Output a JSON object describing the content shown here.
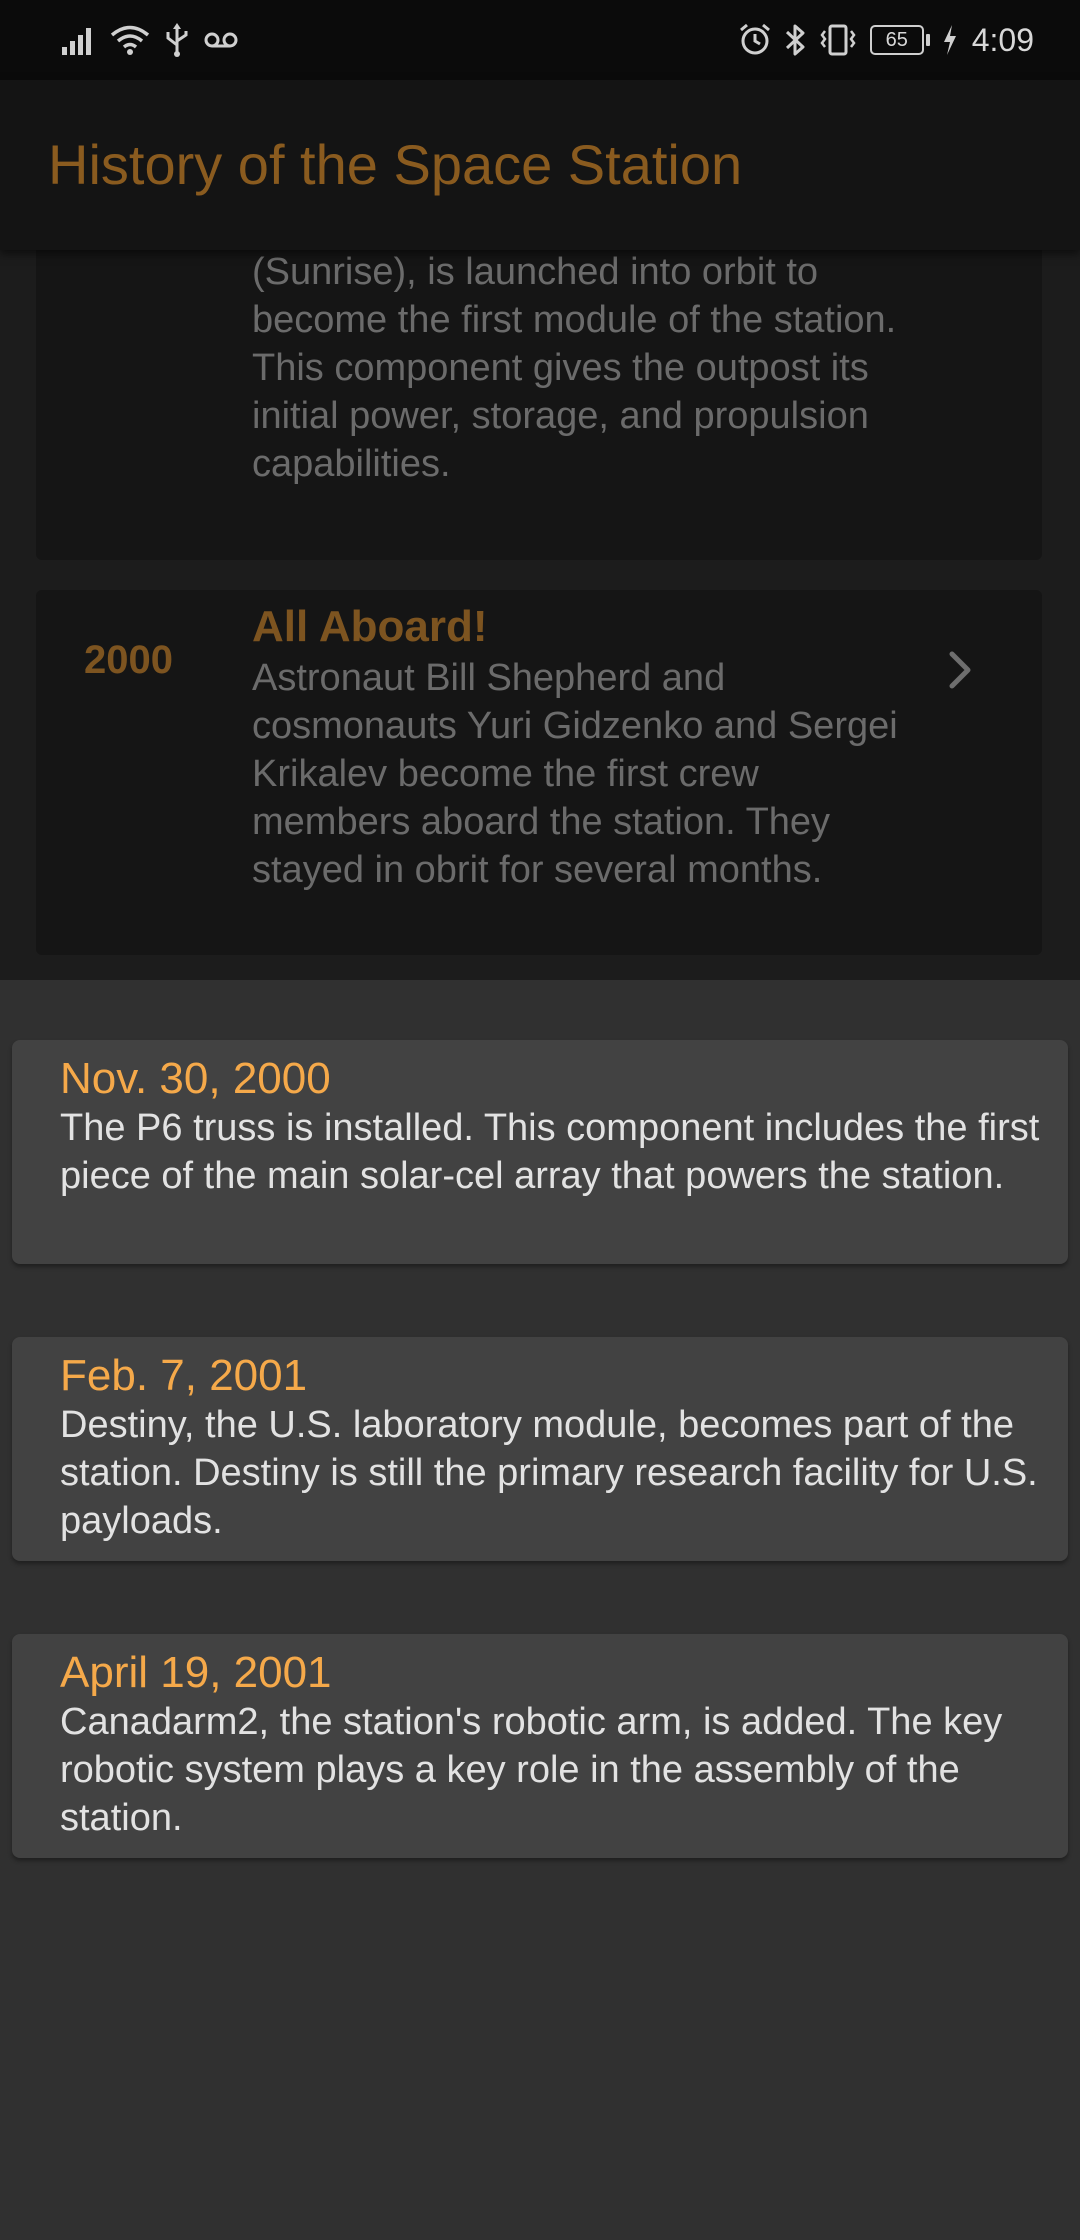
{
  "status_bar": {
    "battery_level": "65",
    "time": "4:09",
    "left_icons": [
      "signal-icon",
      "wifi-icon",
      "usb-icon",
      "voicemail-icon"
    ],
    "right_icons": [
      "alarm-icon",
      "bluetooth-icon",
      "vibrate-icon",
      "battery-icon",
      "charging-icon"
    ]
  },
  "app_bar": {
    "title": "History of the Space Station"
  },
  "timeline": [
    {
      "year": "",
      "headline": "",
      "description": "Cargo Block, known as Zarya (Sunrise), is launched into orbit to become the first module of the station. This component gives the outpost its initial power, storage, and propulsion capabilities."
    },
    {
      "year": "2000",
      "headline": "All Aboard!",
      "description": "Astronaut Bill Shepherd and cosmonauts Yuri Gidzenko and Sergei Krikalev become the first crew members aboard the station. They stayed in obrit for several months."
    }
  ],
  "events": [
    {
      "date": "Nov. 30, 2000",
      "text": "The P6 truss is installed. This component includes the first piece of the main solar-cel array that powers the station."
    },
    {
      "date": "Feb. 7, 2001",
      "text": "Destiny, the U.S. laboratory module, becomes part of the station. Destiny is still the primary research facility for U.S. payloads."
    },
    {
      "date": "April 19, 2001",
      "text": "Canadarm2, the station's robotic arm, is added. The key robotic system plays a key role in the assembly of the station."
    }
  ],
  "colors": {
    "accent": "#f5a94a",
    "accent_dimmed": "#8a5b1f",
    "sheet_background": "#303030",
    "card_background": "#424242"
  }
}
